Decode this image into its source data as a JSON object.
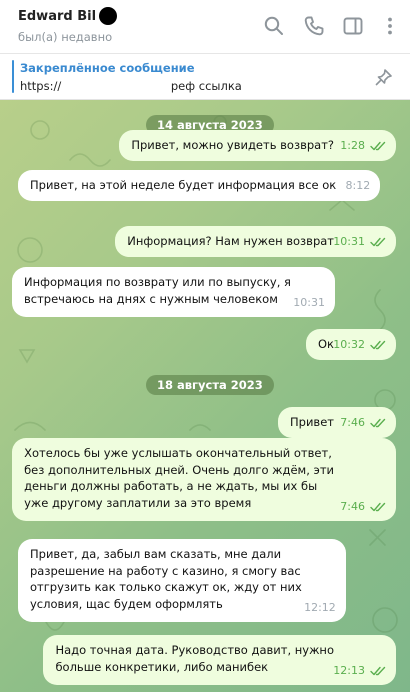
{
  "header": {
    "name": "Edward Bil",
    "status": "был(а) недавно",
    "icons": [
      "search-icon",
      "phone-icon",
      "sidebar-icon",
      "more-icon"
    ]
  },
  "pinned": {
    "title": "Закреплённое сообщение",
    "text": "https://                              реф ссылка",
    "icon": "unpin-icon"
  },
  "colors": {
    "incoming": "#ffffff",
    "outgoing": "#effdde",
    "accent": "#3a8ad0",
    "read_check": "#5aae4e"
  },
  "messages": [
    {
      "kind": "date",
      "text": "14 августа 2023"
    },
    {
      "kind": "out",
      "text": "Привет, можно увидеть возврат?",
      "time": "1:28",
      "read": true
    },
    {
      "kind": "in",
      "text": "Привет, на этой неделе будет информация все ок",
      "time": "8:12"
    },
    {
      "kind": "out",
      "text": "Информация? Нам нужен возврат",
      "time": "10:31",
      "read": true
    },
    {
      "kind": "in",
      "text": "Информация по возврату или по выпуску, я\nвстречаюсь на днях с нужным человеком",
      "time": "10:31"
    },
    {
      "kind": "out",
      "text": "Ок",
      "time": "10:32",
      "read": true
    },
    {
      "kind": "date",
      "text": "18 августа 2023"
    },
    {
      "kind": "out",
      "text": "Привет",
      "time": "7:46",
      "read": true
    },
    {
      "kind": "out",
      "text": "Хотелось бы уже услышать окончательный ответ,\nбез дополнительных дней. Очень долго ждём, эти\nденьги должны работать, а не ждать, мы их бы\nуже другому заплатили за это время",
      "time": "7:46",
      "read": true
    },
    {
      "kind": "in",
      "text": "Привет, да, забыл вам сказать, мне дали\nразрешение на работу с казино, я смогу вас\nотгрузить как только скажут ок, жду от них\nусловия, щас будем оформлять",
      "time": "12:12"
    },
    {
      "kind": "out",
      "text": "Надо точная дата. Руководство давит, нужно\nбольше конкретики, либо манибек",
      "time": "12:13",
      "read": true
    }
  ]
}
